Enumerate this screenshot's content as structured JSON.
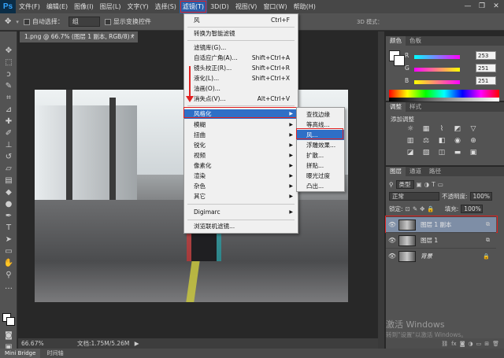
{
  "app": {
    "logo": "Ps"
  },
  "menu": {
    "items": [
      "文件(F)",
      "编辑(E)",
      "图像(I)",
      "图层(L)",
      "文字(Y)",
      "选择(S)",
      "滤镜(T)",
      "3D(D)",
      "视图(V)",
      "窗口(W)",
      "帮助(H)"
    ],
    "active": "滤镜(T)"
  },
  "window_controls": {
    "minimize": "—",
    "restore": "❐",
    "close": "✕"
  },
  "options": {
    "auto_select_label": "自动选择：",
    "auto_select_value": "组",
    "show_transform_label": "显示变换控件",
    "mode_3d_label": "3D 模式："
  },
  "document": {
    "tab_title": "1.png @ 66.7% (图层 1 副本, RGB/8) *",
    "close": "×"
  },
  "filter_menu": {
    "items": [
      {
        "label": "风",
        "shortcut": "Ctrl+F"
      },
      {
        "label": "转换为智能滤镜",
        "shortcut": ""
      },
      {
        "label": "滤镜库(G)...",
        "shortcut": ""
      },
      {
        "label": "自适应广角(A)...",
        "shortcut": "Shift+Ctrl+A"
      },
      {
        "label": "镜头校正(R)...",
        "shortcut": "Shift+Ctrl+R"
      },
      {
        "label": "液化(L)...",
        "shortcut": "Shift+Ctrl+X"
      },
      {
        "label": "油画(O)...",
        "shortcut": ""
      },
      {
        "label": "消失点(V)...",
        "shortcut": "Alt+Ctrl+V"
      },
      {
        "label": "风格化",
        "shortcut": ""
      },
      {
        "label": "模糊",
        "shortcut": ""
      },
      {
        "label": "扭曲",
        "shortcut": ""
      },
      {
        "label": "锐化",
        "shortcut": ""
      },
      {
        "label": "视频",
        "shortcut": ""
      },
      {
        "label": "像素化",
        "shortcut": ""
      },
      {
        "label": "渲染",
        "shortcut": ""
      },
      {
        "label": "杂色",
        "shortcut": ""
      },
      {
        "label": "其它",
        "shortcut": ""
      },
      {
        "label": "Digimarc",
        "shortcut": ""
      },
      {
        "label": "浏览联机滤镜...",
        "shortcut": ""
      }
    ],
    "selected": "风格化"
  },
  "stylize_submenu": {
    "items": [
      "查找边缘",
      "等高线...",
      "风...",
      "浮雕效果...",
      "扩散...",
      "拼贴...",
      "曝光过度",
      "凸出..."
    ],
    "selected": "风..."
  },
  "status": {
    "zoom": "66.67%",
    "doc_size": "文档:1.75M/5.26M"
  },
  "bottom_tabs": [
    "Mini Bridge",
    "时间轴"
  ],
  "color_panel": {
    "tabs": [
      "颜色",
      "色板"
    ],
    "r": "253",
    "g": "251",
    "b": "251",
    "r_label": "R",
    "g_label": "G",
    "b_label": "B"
  },
  "adjust_panel": {
    "tabs": [
      "调整",
      "样式"
    ],
    "title": "添加调整"
  },
  "layers_panel": {
    "tabs": [
      "图层",
      "通道",
      "路径"
    ],
    "kind_label": "类型",
    "blend_mode": "正常",
    "opacity_label": "不透明度:",
    "opacity_value": "100%",
    "lock_label": "锁定:",
    "fill_label": "填充:",
    "fill_value": "100%",
    "layers": [
      {
        "name": "图层 1 副本",
        "selected": true
      },
      {
        "name": "图层 1",
        "selected": false
      },
      {
        "name": "背景",
        "selected": false,
        "locked": true
      }
    ]
  },
  "watermark": {
    "line1": "激活 Windows",
    "line2": "转到\"设置\"以激活 Windows。"
  },
  "colors": {
    "accent": "#2f6fc6",
    "highlight_red": "#e02020"
  }
}
